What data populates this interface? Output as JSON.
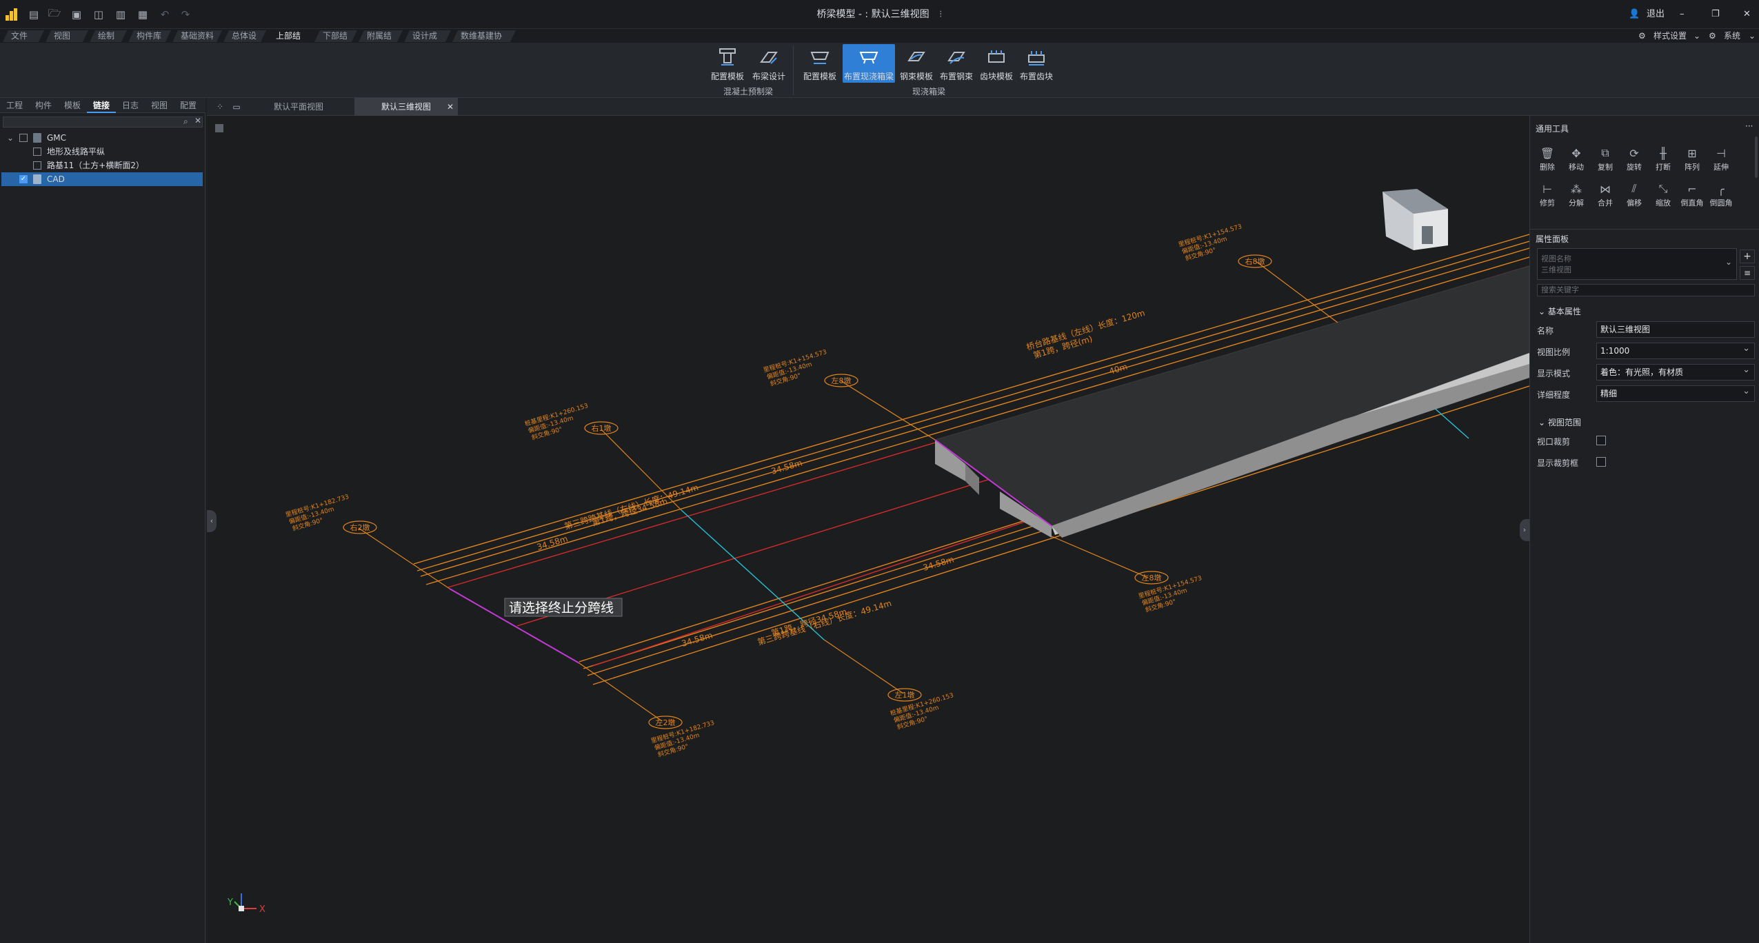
{
  "titlebar": {
    "title": "桥梁模型 - : 默认三维视图",
    "pin": "⁝",
    "logout": "退出",
    "minimize": "–",
    "restore": "❐",
    "close": "✕"
  },
  "menubar": {
    "tabs": [
      "文件",
      "视图",
      "绘制",
      "构件库",
      "基础资料",
      "总体设计",
      "上部结构",
      "下部结构",
      "附属结构",
      "设计成果",
      "数维基建协同"
    ],
    "active": "上部结构",
    "style_settings": "样式设置",
    "system": "系统"
  },
  "ribbon": {
    "groups": [
      {
        "label": "混凝土预制梁",
        "buttons": [
          "配置模板",
          "布梁设计"
        ]
      },
      {
        "label": "现浇箱梁",
        "buttons": [
          "配置模板",
          "布置现浇箱梁",
          "钢束模板",
          "布置钢束",
          "齿块模板",
          "布置齿块"
        ]
      }
    ],
    "selected": "布置现浇箱梁"
  },
  "left_panel": {
    "tabs": [
      "工程",
      "构件",
      "模板",
      "链接",
      "日志",
      "视图",
      "配置"
    ],
    "active_tab": "链接",
    "tree": [
      {
        "label": "GMC",
        "level": 0,
        "checked": false,
        "expanded": true
      },
      {
        "label": "地形及线路平纵",
        "level": 1,
        "checked": false
      },
      {
        "label": "路基11（土方+横断面2）",
        "level": 1,
        "checked": false
      },
      {
        "label": "CAD",
        "level": 0,
        "checked": true,
        "selected": true
      }
    ]
  },
  "doc_tabs": {
    "tabs": [
      "默认平面视图",
      "默认三维视图"
    ],
    "active": "默认三维视图",
    "close": "✕"
  },
  "viewport": {
    "prompt": "请选择终止分跨线",
    "labels": {
      "r1": "右1墩",
      "r2": "右2墩",
      "r8": "右8墩",
      "l1": "左1墩",
      "l2": "左2墩",
      "l8": "左8墩",
      "line_top": "桥台路基线（左线）长度：120m",
      "line_top2": "第1跨，跨径(m)",
      "line_mid": "第三跨跨基线（左线）长度：49.14m",
      "line_mid2": "第1跨，跨径34.58m",
      "line_low": "第三跨跨基线（右线）长度：49.14m",
      "line_low2": "第1跨，跨径34.58m",
      "span1": "34.58m",
      "span2": "34.58m",
      "span3": "40m",
      "span4": "34.58m",
      "span5": "34.58m",
      "pier_note_a": "里程桩号:K1+154.573",
      "pier_note_b": "桩基里程:K1+260.153",
      "pier_note_c": "里程桩号:K1+182.733",
      "pier_note_sub1": "偏距值:-13.40m",
      "pier_note_sub2": "斜交角:90°"
    },
    "axis_y": "Y",
    "axis_x": "X"
  },
  "right_panel": {
    "tools_title": "通用工具",
    "more": "···",
    "tools_row1": [
      "删除",
      "移动",
      "复制",
      "旋转",
      "打断",
      "阵列",
      "延伸"
    ],
    "tools_row2": [
      "修剪",
      "分解",
      "合并",
      "偏移",
      "缩放",
      "倒直角",
      "倒圆角"
    ],
    "properties_title": "属性面板",
    "view_name_placeholder": "视图名称",
    "view_name_value": "三维视图",
    "search_placeholder": "搜索关键字",
    "basic_section": "基本属性",
    "props": [
      {
        "label": "名称",
        "value": "默认三维视图",
        "type": "text"
      },
      {
        "label": "视图比例",
        "value": "1:1000",
        "type": "select"
      },
      {
        "label": "显示模式",
        "value": "着色：有光照，有材质",
        "type": "select"
      },
      {
        "label": "详细程度",
        "value": "精细",
        "type": "select"
      }
    ],
    "range_section": "视图范围",
    "range_props": [
      {
        "label": "视口裁剪",
        "checked": false
      },
      {
        "label": "显示裁剪框",
        "checked": false
      }
    ]
  },
  "colors": {
    "accent": "#2f7fd6",
    "orange": "#e0841e",
    "red": "#d42a2a",
    "cyan": "#22c2d6",
    "magenta": "#c23ad6"
  }
}
